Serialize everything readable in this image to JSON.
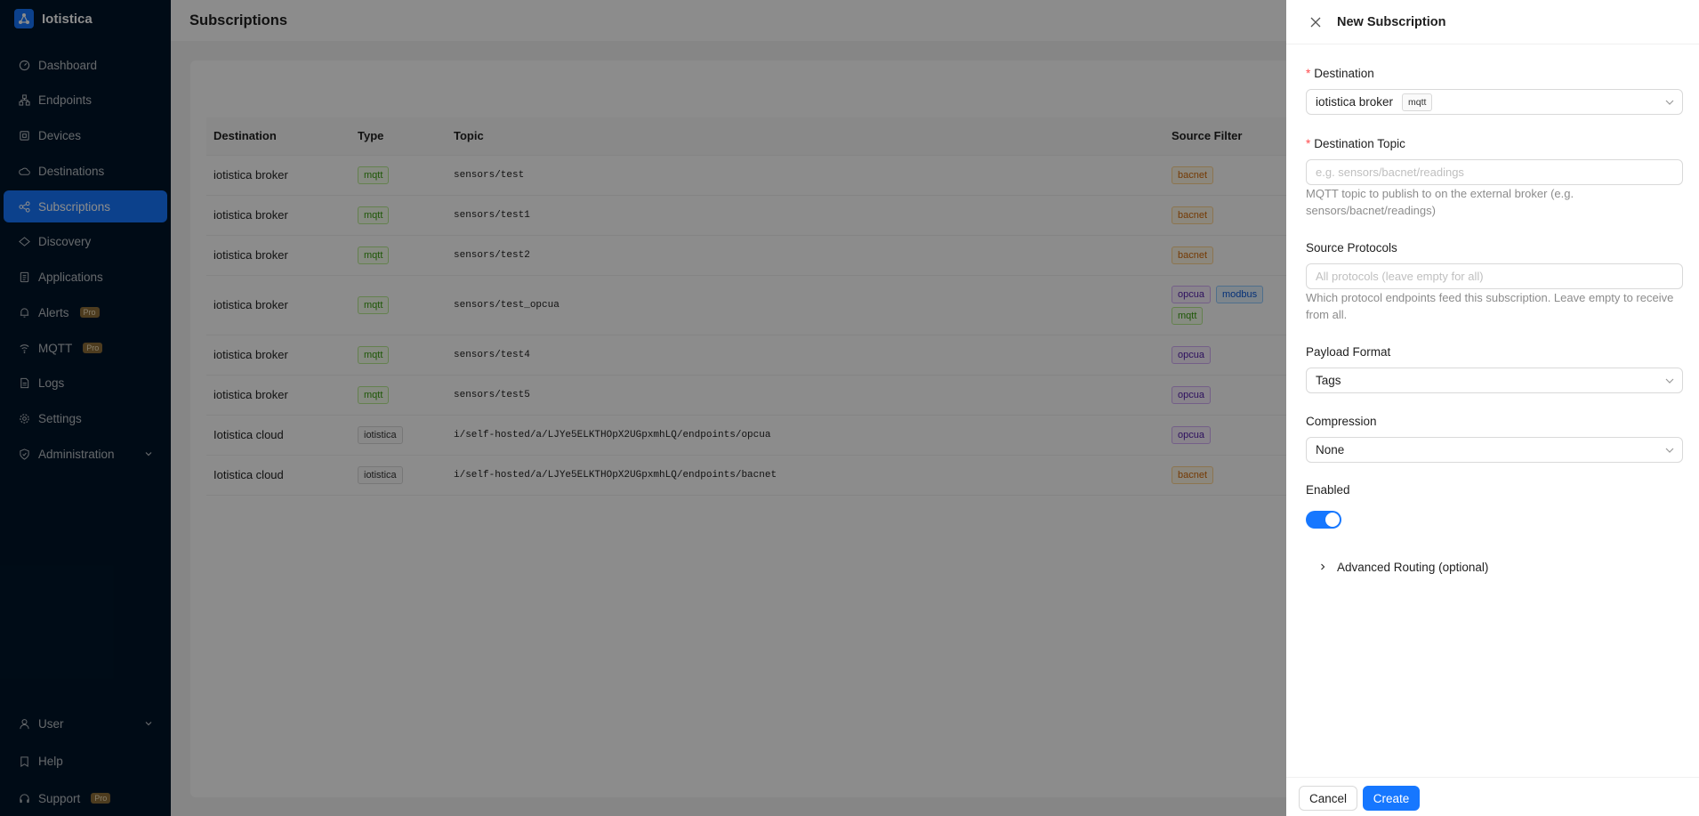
{
  "app": {
    "name": "Iotistica"
  },
  "sidebar": {
    "items": [
      {
        "label": "Dashboard",
        "icon": "dashboard-icon"
      },
      {
        "label": "Endpoints",
        "icon": "endpoints-icon"
      },
      {
        "label": "Devices",
        "icon": "devices-icon"
      },
      {
        "label": "Destinations",
        "icon": "destinations-icon"
      },
      {
        "label": "Subscriptions",
        "icon": "subscriptions-icon",
        "active": true
      },
      {
        "label": "Discovery",
        "icon": "discovery-icon"
      },
      {
        "label": "Applications",
        "icon": "applications-icon"
      },
      {
        "label": "Alerts",
        "icon": "alerts-icon",
        "badge": "Pro"
      },
      {
        "label": "MQTT",
        "icon": "mqtt-icon",
        "badge": "Pro"
      },
      {
        "label": "Logs",
        "icon": "logs-icon"
      },
      {
        "label": "Settings",
        "icon": "settings-icon"
      },
      {
        "label": "Administration",
        "icon": "administration-icon"
      }
    ],
    "bottom": [
      {
        "label": "User",
        "icon": "user-icon"
      },
      {
        "label": "Help",
        "icon": "help-icon"
      },
      {
        "label": "Support",
        "icon": "support-icon",
        "badge": "Pro"
      }
    ]
  },
  "page": {
    "title": "Subscriptions"
  },
  "table": {
    "columns": [
      "Destination",
      "Type",
      "Topic",
      "Source Filter"
    ],
    "rows": [
      {
        "destination": "iotistica broker",
        "type": "mqtt",
        "topic": "sensors/test",
        "filters": [
          "bacnet"
        ]
      },
      {
        "destination": "iotistica broker",
        "type": "mqtt",
        "topic": "sensors/test1",
        "filters": [
          "bacnet"
        ]
      },
      {
        "destination": "iotistica broker",
        "type": "mqtt",
        "topic": "sensors/test2",
        "filters": [
          "bacnet"
        ]
      },
      {
        "destination": "iotistica broker",
        "type": "mqtt",
        "topic": "sensors/test_opcua",
        "filters": [
          "opcua",
          "modbus",
          "mqtt"
        ]
      },
      {
        "destination": "iotistica broker",
        "type": "mqtt",
        "topic": "sensors/test4",
        "filters": [
          "opcua"
        ]
      },
      {
        "destination": "iotistica broker",
        "type": "mqtt",
        "topic": "sensors/test5",
        "filters": [
          "opcua"
        ]
      },
      {
        "destination": "Iotistica cloud",
        "type": "iotistica",
        "topic": "i/self-hosted/a/LJYe5ELKTHOpX2UGpxmhLQ/endpoints/opcua",
        "filters": [
          "opcua"
        ]
      },
      {
        "destination": "Iotistica cloud",
        "type": "iotistica",
        "topic": "i/self-hosted/a/LJYe5ELKTHOpX2UGpxmhLQ/endpoints/bacnet",
        "filters": [
          "bacnet"
        ]
      }
    ]
  },
  "drawer": {
    "title": "New Subscription",
    "destination": {
      "label": "Destination",
      "value": "iotistica broker",
      "tag": "mqtt"
    },
    "destination_topic": {
      "label": "Destination Topic",
      "placeholder": "e.g. sensors/bacnet/readings",
      "value": "",
      "help": "MQTT topic to publish to on the external broker (e.g. sensors/bacnet/readings)"
    },
    "source_protocols": {
      "label": "Source Protocols",
      "placeholder": "All protocols (leave empty for all)",
      "help": "Which protocol endpoints feed this subscription. Leave empty to receive from all."
    },
    "payload_format": {
      "label": "Payload Format",
      "value": "Tags"
    },
    "compression": {
      "label": "Compression",
      "value": "None"
    },
    "enabled": {
      "label": "Enabled",
      "value": true
    },
    "advanced": {
      "label": "Advanced Routing (optional)"
    },
    "cancel_label": "Cancel",
    "create_label": "Create"
  },
  "colors": {
    "primary": "#1677ff",
    "sidebar_bg": "#001529"
  }
}
